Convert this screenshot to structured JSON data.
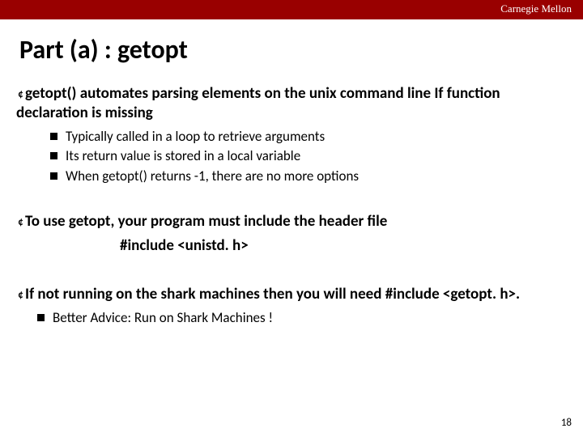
{
  "brand": "Carnegie Mellon",
  "title": "Part (a) :  getopt",
  "point1": {
    "lead": "getopt()",
    "rest": " automates parsing elements on the unix command line If function declaration is missing"
  },
  "sub1": [
    "Typically called in a loop to retrieve arguments",
    "Its return value is stored in a local variable",
    "When getopt() returns -1, there are no more options"
  ],
  "point2": {
    "text": "To use getopt, your program must include the header  file",
    "include": "#include <unistd. h>"
  },
  "point3": {
    "text": "If not running on the shark machines then you will need #include <getopt. h>."
  },
  "sub3": [
    "Better Advice: Run on Shark Machines !"
  ],
  "pagenum": "18",
  "circle_glyph": "¢"
}
